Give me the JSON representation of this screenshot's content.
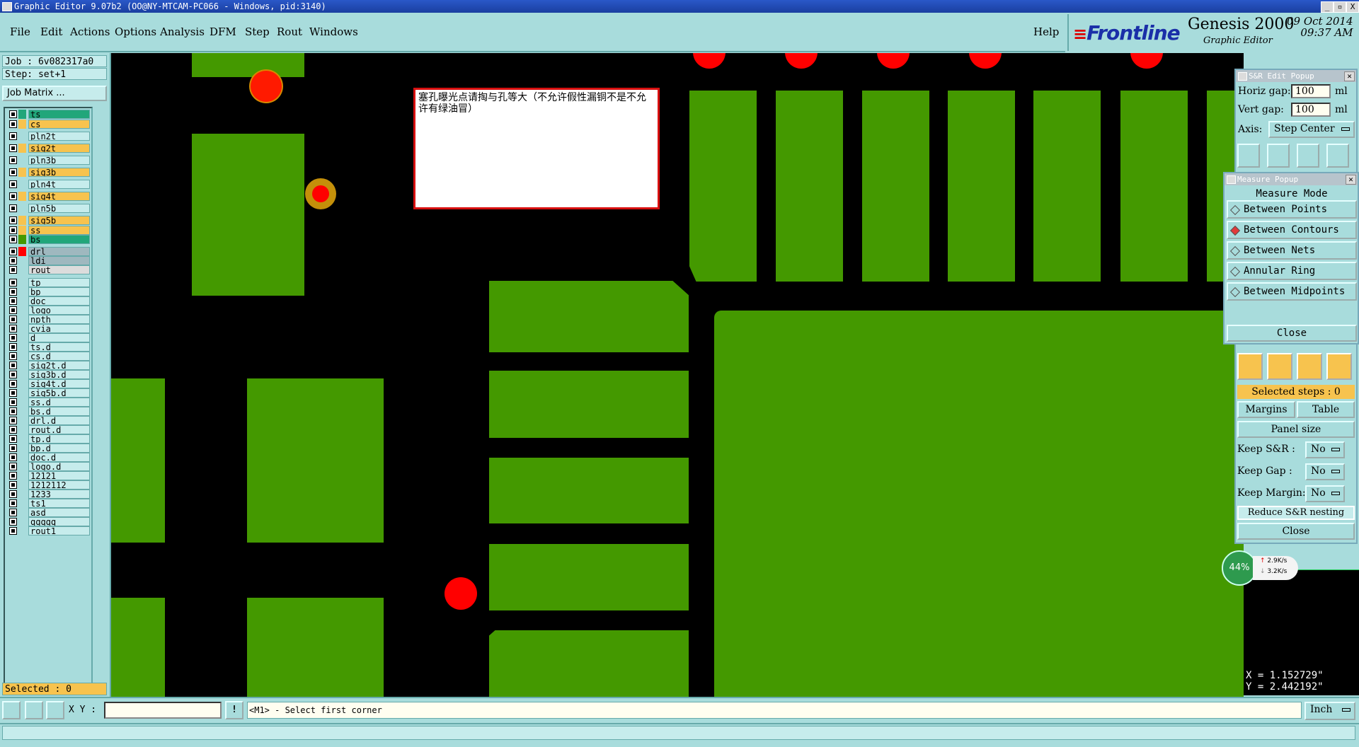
{
  "window": {
    "title": "Graphic Editor 9.07b2 (OO@NY-MTCAM-PC066 - Windows, pid:3140)",
    "controls": [
      "_",
      "▫",
      "X"
    ]
  },
  "menu": {
    "items": [
      "File",
      "Edit",
      "Actions",
      "Options",
      "Analysis",
      "DFM",
      "Step",
      "Rout",
      "Windows"
    ],
    "help": "Help"
  },
  "brand": {
    "logo": "Frontline",
    "product": "Genesis 2000",
    "subtitle": "Graphic Editor",
    "date": "09 Oct 2014",
    "time": "09:37 AM"
  },
  "job": {
    "job_label": "Job : 6v082317a0",
    "step_label": "Step: set+1",
    "matrix_button": "Job Matrix ..."
  },
  "layers": [
    {
      "name": "ts",
      "color": "#21a67a",
      "nameBg": "#21a67a"
    },
    {
      "name": "cs",
      "color": "#f7c34e",
      "nameBg": "#f7c34e"
    },
    {
      "name": "pln2t",
      "color": "",
      "nameBg": "#c6ecec"
    },
    {
      "name": "sig2t",
      "color": "#f7c34e",
      "nameBg": "#f7c34e"
    },
    {
      "name": "pln3b",
      "color": "",
      "nameBg": "#c6ecec"
    },
    {
      "name": "sig3b",
      "color": "#f7c34e",
      "nameBg": "#f7c34e"
    },
    {
      "name": "pln4t",
      "color": "",
      "nameBg": "#c6ecec"
    },
    {
      "name": "sig4t",
      "color": "#f7c34e",
      "nameBg": "#f7c34e"
    },
    {
      "name": "pln5b",
      "color": "",
      "nameBg": "#c6ecec"
    },
    {
      "name": "sig5b",
      "color": "#f7c34e",
      "nameBg": "#f7c34e"
    },
    {
      "name": "ss",
      "color": "#f7c34e",
      "nameBg": "#f7c34e"
    },
    {
      "name": "bs",
      "color": "#449900",
      "nameBg": "#21a67a"
    },
    {
      "name": "drl",
      "color": "#ff0000",
      "nameBg": "#9fb8bf"
    },
    {
      "name": "ldi",
      "color": "",
      "nameBg": "#9fb8bf"
    },
    {
      "name": "rout",
      "color": "",
      "nameBg": "#dcdcdc"
    },
    {
      "name": "tp",
      "color": "",
      "nameBg": "#c6ecec"
    },
    {
      "name": "bp",
      "color": "",
      "nameBg": "#c6ecec"
    },
    {
      "name": "doc",
      "color": "",
      "nameBg": "#c6ecec"
    },
    {
      "name": "logo",
      "color": "",
      "nameBg": "#c6ecec"
    },
    {
      "name": "npth",
      "color": "",
      "nameBg": "#c6ecec"
    },
    {
      "name": "cvia",
      "color": "",
      "nameBg": "#c6ecec"
    },
    {
      "name": "d",
      "color": "",
      "nameBg": "#c6ecec"
    },
    {
      "name": "ts.d",
      "color": "",
      "nameBg": "#c6ecec"
    },
    {
      "name": "cs.d",
      "color": "",
      "nameBg": "#c6ecec"
    },
    {
      "name": "sig2t.d",
      "color": "",
      "nameBg": "#c6ecec"
    },
    {
      "name": "sig3b.d",
      "color": "",
      "nameBg": "#c6ecec"
    },
    {
      "name": "sig4t.d",
      "color": "",
      "nameBg": "#c6ecec"
    },
    {
      "name": "sig5b.d",
      "color": "",
      "nameBg": "#c6ecec"
    },
    {
      "name": "ss.d",
      "color": "",
      "nameBg": "#c6ecec"
    },
    {
      "name": "bs.d",
      "color": "",
      "nameBg": "#c6ecec"
    },
    {
      "name": "drl.d",
      "color": "",
      "nameBg": "#c6ecec"
    },
    {
      "name": "rout.d",
      "color": "",
      "nameBg": "#c6ecec"
    },
    {
      "name": "tp.d",
      "color": "",
      "nameBg": "#c6ecec"
    },
    {
      "name": "bp.d",
      "color": "",
      "nameBg": "#c6ecec"
    },
    {
      "name": "doc.d",
      "color": "",
      "nameBg": "#c6ecec"
    },
    {
      "name": "logo.d",
      "color": "",
      "nameBg": "#c6ecec"
    },
    {
      "name": "12121",
      "color": "",
      "nameBg": "#c6ecec"
    },
    {
      "name": "1212112",
      "color": "",
      "nameBg": "#c6ecec"
    },
    {
      "name": "1233",
      "color": "",
      "nameBg": "#c6ecec"
    },
    {
      "name": "ts1",
      "color": "",
      "nameBg": "#c6ecec"
    },
    {
      "name": "asd",
      "color": "",
      "nameBg": "#c6ecec"
    },
    {
      "name": "qqqqq",
      "color": "",
      "nameBg": "#c6ecec"
    },
    {
      "name": "rout1",
      "color": "",
      "nameBg": "#c6ecec"
    }
  ],
  "selected_label": "Selected : 0",
  "note_text": "塞孔曝光点请掏与孔等大（不允许假性漏铜不是不允许有绿油冒）",
  "sr_popup": {
    "title": "S&R Edit Popup",
    "horiz_label": "Horiz gap:",
    "horiz_value": "100",
    "vert_label": "Vert  gap:",
    "vert_value": "100",
    "unit": "ml",
    "axis_label": "Axis:",
    "axis_value": "Step Center",
    "selected_steps": "Selected steps : 0",
    "margins": "Margins",
    "table": "Table",
    "panel_size": "Panel size",
    "keep_sr_label": "Keep S&R   :",
    "keep_gap_label": "Keep Gap    :",
    "keep_margin_label": "Keep Margin:",
    "keep_sr": "No",
    "keep_gap": "No",
    "keep_margin": "No",
    "reduce": "Reduce S&R nesting",
    "close": "Close"
  },
  "measure_popup": {
    "title": "Measure Popup",
    "header": "Measure Mode",
    "modes": [
      "Between Points",
      "Between Contours",
      "Between Nets",
      "Annular Ring",
      "Between Midpoints"
    ],
    "active_mode": "Between Contours",
    "close": "Close"
  },
  "net": {
    "percent": "44%",
    "up": "2.9K/s",
    "down": "3.2K/s"
  },
  "coords": {
    "x": "X = 1.152729\"",
    "y": "Y = 2.442192\""
  },
  "cmd": {
    "xy_label": "X Y :",
    "xy_value": "",
    "prompt": "<M1> - Select first corner",
    "units": "Inch"
  }
}
